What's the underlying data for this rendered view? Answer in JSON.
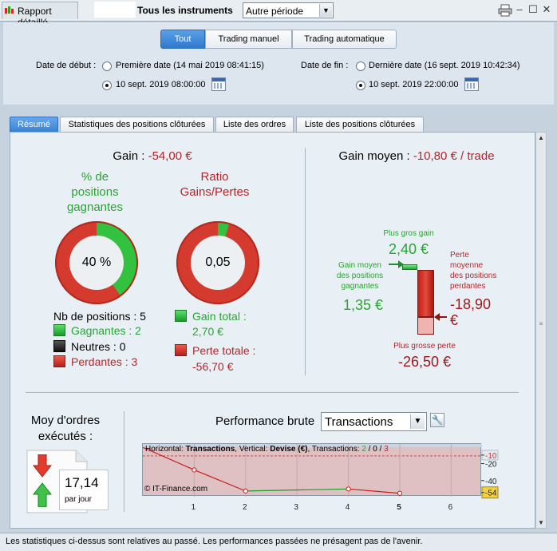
{
  "toolbar": {
    "report_tab": "Rapport détaillé",
    "instruments_label": "Tous les instruments",
    "period_value": "Autre période"
  },
  "filters": {
    "segments": [
      "Tout",
      "Trading manuel",
      "Trading automatique"
    ],
    "selected_segment": "Tout",
    "start_label": "Date de début :",
    "start_option_first": "Première date (14 mai 2019 08:41:15)",
    "start_option_custom": "10 sept. 2019 08:00:00",
    "end_label": "Date de fin :",
    "end_option_last": "Dernière date (16 sept. 2019 10:42:34)",
    "end_option_custom": "10 sept. 2019 22:00:00"
  },
  "tabs": [
    "Résumé",
    "Statistiques des positions clôturées",
    "Liste des ordres",
    "Liste des positions clôturées"
  ],
  "summary": {
    "gain_label": "Gain :",
    "gain_value": "-54,00 €",
    "pct_title_1": "% de",
    "pct_title_2": "positions",
    "pct_title_3": "gagnantes",
    "pct_value": "40 %",
    "pct_fraction": 0.4,
    "ratio_title_1": "Ratio",
    "ratio_title_2": "Gains/Pertes",
    "ratio_value": "0,05",
    "ratio_fraction": 0.045,
    "nb_positions": "Nb de positions : 5",
    "gagnantes": "Gagnantes : 2",
    "neutres": "Neutres : 0",
    "perdantes": "Perdantes : 3",
    "gain_total_label": "Gain total :",
    "gain_total_value": "2,70 €",
    "perte_totale_label": "Perte totale :",
    "perte_totale_value": "-56,70 €"
  },
  "average": {
    "title": "Gain moyen :",
    "value": "-10,80 € / trade",
    "plus_gros_gain_label": "Plus gros gain",
    "plus_gros_gain_value": "2,40 €",
    "gain_moyen_label_1": "Gain moyen",
    "gain_moyen_label_2": "des positions",
    "gain_moyen_label_3": "gagnantes",
    "gain_moyen_value": "1,35 €",
    "perte_moyenne_label_1": "Perte",
    "perte_moyenne_label_2": "moyenne",
    "perte_moyenne_label_3": "des positions",
    "perte_moyenne_label_4": "perdantes",
    "perte_moyenne_value_1": "-18,90",
    "perte_moyenne_value_2": "€",
    "plus_grosse_perte_label": "Plus grosse perte",
    "plus_grosse_perte_value": "-26,50 €"
  },
  "orders": {
    "title_1": "Moy d'ordres",
    "title_2": "exécutés :",
    "value": "17,14",
    "unit": "par jour"
  },
  "performance": {
    "title": "Performance brute",
    "select_value": "Transactions",
    "info_horizontal": "Horizontal:",
    "info_h_value": "Transactions",
    "info_vertical": ", Vertical:",
    "info_v_value": "Devise (€)",
    "info_trans": ", Transactions:",
    "info_count_win": "2",
    "info_slash1": " / ",
    "info_count_neutral": "0",
    "info_slash2": " / ",
    "info_count_loss": "3",
    "copyright": "© IT-Finance.com"
  },
  "chart_data": {
    "type": "line",
    "x": [
      0,
      1,
      2,
      3,
      4,
      5
    ],
    "y": [
      0,
      -26.5,
      -51.3,
      null,
      -48.9,
      -54
    ],
    "series": [
      {
        "values": [
          0,
          -26.5,
          -51.3,
          null,
          null,
          null
        ]
      },
      {
        "values": [
          null,
          null,
          -51.3,
          null,
          -48.9,
          null
        ]
      },
      {
        "values": [
          null,
          null,
          null,
          null,
          -48.9,
          -54
        ]
      }
    ],
    "x_ticks": [
      "1",
      "2",
      "3",
      "4",
      "5",
      "6"
    ],
    "y_ticks": [
      "-10",
      "-20",
      "-40",
      "-54"
    ],
    "xlim": [
      0,
      6.6
    ],
    "ylim": [
      -58,
      4
    ],
    "current_value": "-54",
    "reference_value": "-10",
    "colors": {
      "loss": "#c81e1e",
      "gain": "#1e9a2a",
      "fill": "#dfc0c3"
    }
  },
  "footer": {
    "disclaimer": "Les statistiques ci-dessus sont relatives au passé. Les performances passées ne présagent pas de l'avenir."
  }
}
